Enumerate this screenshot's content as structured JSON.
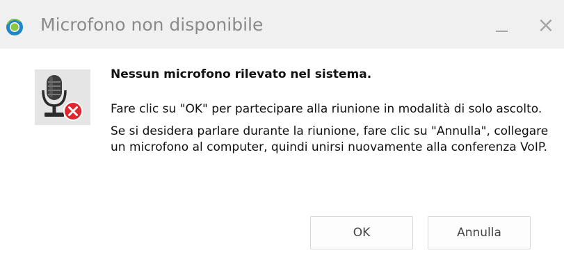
{
  "window": {
    "title": "Microfono non disponibile",
    "minimize_glyph": "",
    "close_glyph": "×",
    "app_icon": "conference-app-icon"
  },
  "dialog": {
    "icon": "microphone-error-icon",
    "headline": "Nessun microfono rilevato nel sistema.",
    "paragraphs": [
      "Fare clic su \"OK\" per partecipare alla riunione in modalità di solo ascolto.",
      "Se si desidera parlare durante la riunione, fare clic su \"Annulla\", collegare un microfono al computer, quindi unirsi nuovamente alla conferenza VoIP."
    ]
  },
  "buttons": {
    "ok_label": "OK",
    "cancel_label": "Annulla"
  },
  "colors": {
    "titlebar_bg": "#f0f0f0",
    "title_text": "#8a8a8a",
    "error_red": "#e0262e",
    "app_icon_blue": "#1f86c8",
    "app_icon_green": "#8dc63f"
  }
}
